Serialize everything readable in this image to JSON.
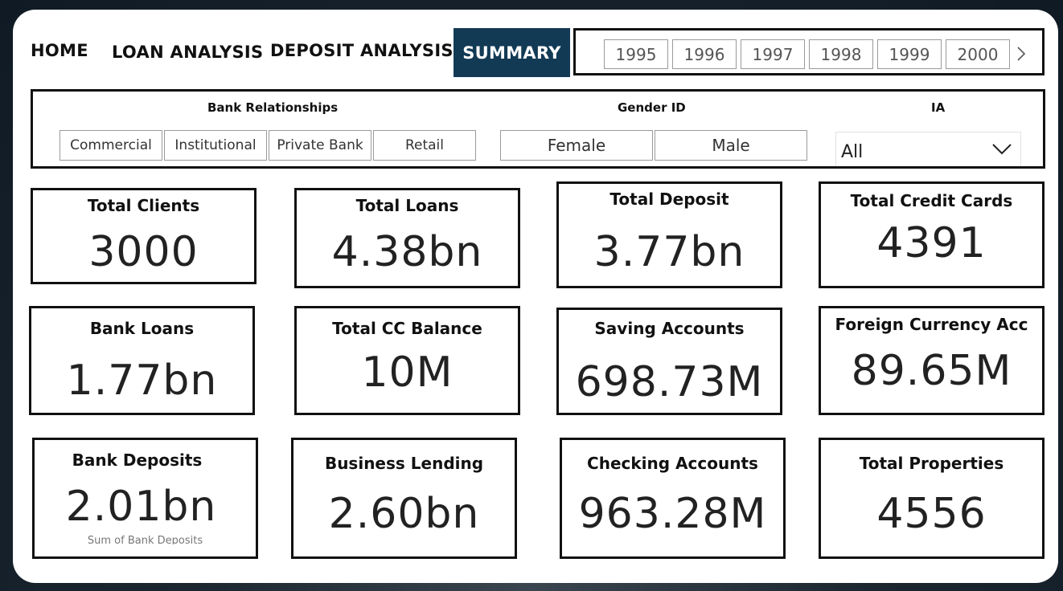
{
  "nav": {
    "home": "HOME",
    "loan_analysis": "LOAN ANALYSIS",
    "deposit_analysis": "DEPOSIT ANALYSIS",
    "summary": "SUMMARY"
  },
  "years": [
    "1995",
    "1996",
    "1997",
    "1998",
    "1999",
    "2000"
  ],
  "filters": {
    "bank_relationships": {
      "title": "Bank Relationships",
      "options": [
        "Commercial",
        "Institutional",
        "Private Bank",
        "Retail"
      ]
    },
    "gender": {
      "title": "Gender ID",
      "options": [
        "Female",
        "Male"
      ]
    },
    "ia": {
      "title": "IA",
      "selected": "All"
    }
  },
  "cards": [
    {
      "title": "Total Clients",
      "value": "3000"
    },
    {
      "title": "Total Loans",
      "value": "4.38bn"
    },
    {
      "title": "Total Deposit",
      "value": "3.77bn"
    },
    {
      "title": "Total Credit Cards",
      "value": "4391"
    },
    {
      "title": "Bank Loans",
      "value": "1.77bn"
    },
    {
      "title": "Total CC Balance",
      "value": "10M"
    },
    {
      "title": "Saving Accounts",
      "value": "698.73M"
    },
    {
      "title": "Foreign Currency Acc",
      "value": "89.65M"
    },
    {
      "title": "Bank Deposits",
      "value": "2.01bn",
      "sub": "Sum of Bank Deposits"
    },
    {
      "title": "Business Lending",
      "value": "2.60bn"
    },
    {
      "title": "Checking Accounts",
      "value": "963.28M"
    },
    {
      "title": "Total Properties",
      "value": "4556"
    }
  ],
  "colors": {
    "active_tab": "#123a55",
    "border": "#111111",
    "panel": "#ffffff"
  }
}
